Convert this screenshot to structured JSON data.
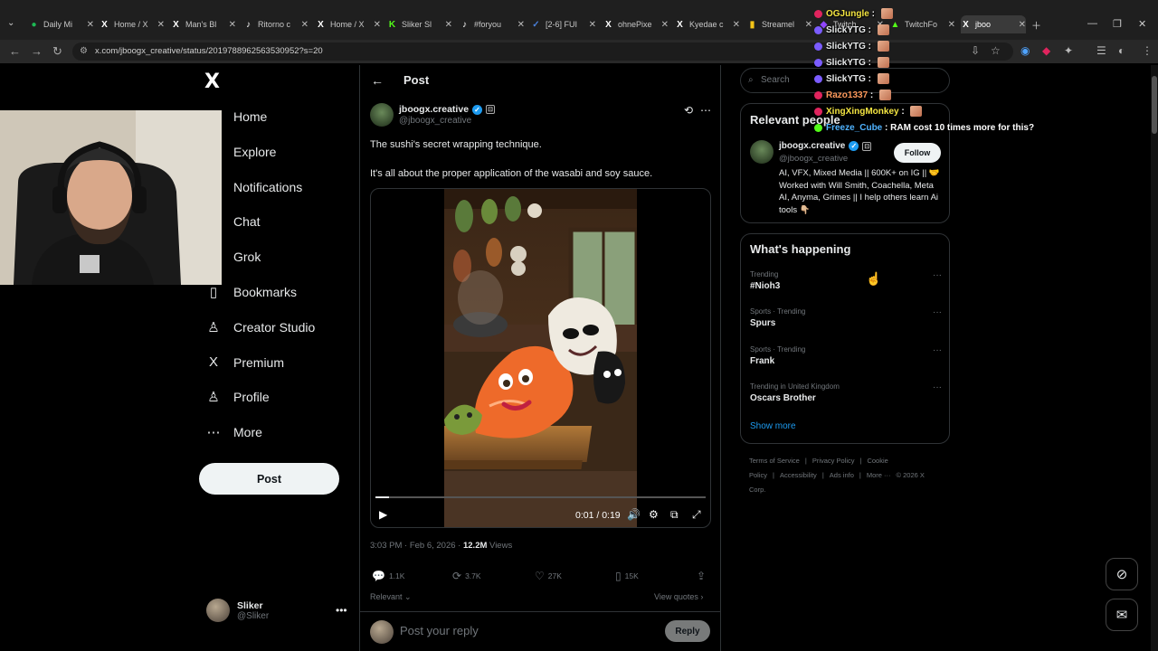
{
  "browser": {
    "tabs": [
      {
        "label": "Daily Mi",
        "fav": "●",
        "color": "#1db954"
      },
      {
        "label": "Home / X",
        "fav": "X",
        "color": "#ffffff"
      },
      {
        "label": "Man's Bl",
        "fav": "X",
        "color": "#ffffff"
      },
      {
        "label": "Ritorno c",
        "fav": "♪",
        "color": "#ffffff"
      },
      {
        "label": "Home / X",
        "fav": "X",
        "color": "#ffffff"
      },
      {
        "label": "Sliker Sl",
        "fav": "K",
        "color": "#53fc18"
      },
      {
        "label": "#foryou",
        "fav": "♪",
        "color": "#ffffff"
      },
      {
        "label": "[2-6] FUI",
        "fav": "✓",
        "color": "#4a7fd8"
      },
      {
        "label": "ohnePixe",
        "fav": "X",
        "color": "#ffffff"
      },
      {
        "label": "Kyedae c",
        "fav": "X",
        "color": "#ffffff"
      },
      {
        "label": "Streamel",
        "fav": "▮",
        "color": "#f5c518"
      },
      {
        "label": "Twitch",
        "fav": "◆",
        "color": "#9146ff"
      },
      {
        "label": "TwitchFo",
        "fav": "▲",
        "color": "#53fc18"
      },
      {
        "label": "jboo",
        "fav": "X",
        "color": "#ffffff"
      }
    ],
    "url": "x.com/jboogx_creative/status/2019788962563530952?s=20"
  },
  "nav": {
    "logo": "X",
    "items": [
      {
        "label": "Home",
        "icon": "⌂"
      },
      {
        "label": "Explore",
        "icon": "⌕"
      },
      {
        "label": "Notifications",
        "icon": "🔔"
      },
      {
        "label": "Chat",
        "icon": "✉"
      },
      {
        "label": "Grok",
        "icon": "◪"
      },
      {
        "label": "Bookmarks",
        "icon": "▯"
      },
      {
        "label": "Creator Studio",
        "icon": "♙"
      },
      {
        "label": "Premium",
        "icon": "X"
      },
      {
        "label": "Profile",
        "icon": "♙"
      },
      {
        "label": "More",
        "icon": "⋯"
      }
    ],
    "post_label": "Post",
    "account": {
      "name": "Sliker",
      "handle": "@Sliker"
    }
  },
  "post": {
    "header_title": "Post",
    "author_name": "jboogx.creative",
    "author_handle": "@jboogx_creative",
    "text_1": "The sushi's secret wrapping technique.",
    "text_2": "It's all about the proper application of the wasabi and soy sauce.",
    "video": {
      "current": "0:01",
      "duration": "0:19",
      "progress": 0.04
    },
    "timestamp": "3:03 PM · Feb 6, 2026 · ",
    "views_count": "12.2M",
    "views_label": " Views",
    "replies": "1.1K",
    "reposts": "3.7K",
    "likes": "27K",
    "bookmarks": "15K",
    "sort_label": "Relevant",
    "view_quotes": "View quotes",
    "reply_placeholder": "Post your reply",
    "reply_button": "Reply"
  },
  "sidebar": {
    "search_placeholder": "Search",
    "relevant_title": "Relevant people",
    "person": {
      "name": "jboogx.creative",
      "handle": "@jboogx_creative",
      "bio": "AI, VFX, Mixed Media || 600K+ on IG || 🤝 Worked with Will Smith, Coachella, Meta AI, Anyma, Grimes || I help others learn Ai tools 👇🏼",
      "follow_label": "Follow"
    },
    "happening_title": "What's happening",
    "trends": [
      {
        "meta": "Trending",
        "name": "#Nioh3"
      },
      {
        "meta": "Sports · Trending",
        "name": "Spurs"
      },
      {
        "meta": "Sports · Trending",
        "name": "Frank"
      },
      {
        "meta": "Trending in United Kingdom",
        "name": "Oscars Brother"
      }
    ],
    "show_more": "Show more",
    "footer": [
      "Terms of Service",
      "|",
      "Privacy Policy",
      "|",
      "Cookie Policy",
      "|",
      "Accessibility",
      "|",
      "Ads info",
      "|",
      "More ···",
      "© 2026 X Corp."
    ]
  },
  "chat": [
    {
      "user": "OGJungle",
      "msg": "",
      "color": "#f5e642",
      "badge": "#e0245e"
    },
    {
      "user": "SlickYTG",
      "msg": "",
      "color": "#e7e9ea",
      "badge": "#7b5cff"
    },
    {
      "user": "SlickYTG",
      "msg": "",
      "color": "#e7e9ea",
      "badge": "#7b5cff"
    },
    {
      "user": "SlickYTG",
      "msg": "",
      "color": "#e7e9ea",
      "badge": "#7b5cff"
    },
    {
      "user": "SlickYTG",
      "msg": "",
      "color": "#e7e9ea",
      "badge": "#7b5cff"
    },
    {
      "user": "Razo1337",
      "msg": "",
      "color": "#ff9a5c",
      "badge": "#e0245e"
    },
    {
      "user": "XingXingMonkey",
      "msg": "",
      "color": "#f5e642",
      "badge": "#e0245e"
    },
    {
      "user": "Freeze_Cube",
      "msg": "RAM cost 10 times more for this?",
      "color": "#4fb3ff",
      "badge": "#53fc18"
    }
  ]
}
